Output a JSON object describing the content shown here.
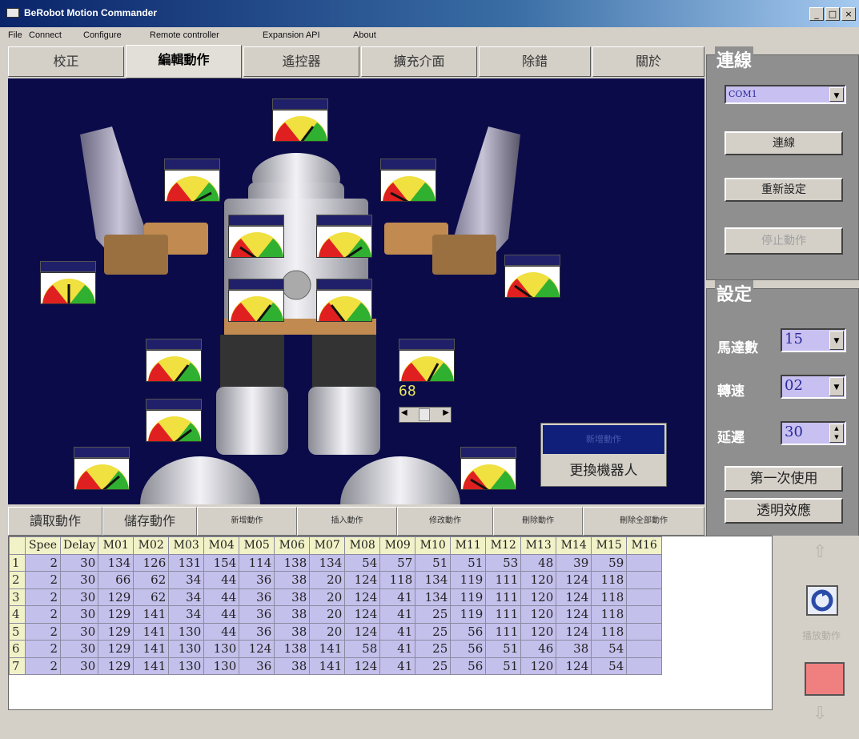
{
  "window": {
    "title": "BeRobot Motion Commander",
    "min": "_",
    "max": "□",
    "close": "×"
  },
  "menu": [
    "File",
    "Connect",
    "Configure",
    "Remote controller",
    "Expansion API",
    "About"
  ],
  "tabs": [
    "校正",
    "編輯動作",
    "遙控器",
    "擴充介面",
    "除錯",
    "關於"
  ],
  "active_tab": 1,
  "robot_view": {
    "gauge_value": "68",
    "popup_top": "新增動作",
    "popup_bottom": "更換機器人"
  },
  "connection": {
    "title": "連線",
    "port": "COM1",
    "connect_button": "連線",
    "reset_button": "重新設定",
    "stop_button": "停止動作"
  },
  "settings": {
    "title": "設定",
    "motor_count_label": "馬達數",
    "motor_count": "15",
    "speed_label": "轉速",
    "speed": "02",
    "delay_label": "延遲",
    "delay": "30",
    "first_use_button": "第一次使用",
    "transparent_button": "透明效應"
  },
  "actions": [
    "讀取動作",
    "儲存動作",
    "新增動作",
    "插入動作",
    "修改動作",
    "刪除動作",
    "刪除全部動作"
  ],
  "table": {
    "headers": [
      "",
      "Spee",
      "Delay",
      "M01",
      "M02",
      "M03",
      "M04",
      "M05",
      "M06",
      "M07",
      "M08",
      "M09",
      "M10",
      "M11",
      "M12",
      "M13",
      "M14",
      "M15",
      "M16"
    ],
    "rows": [
      [
        "1",
        "2",
        "30",
        "134",
        "126",
        "131",
        "154",
        "114",
        "138",
        "134",
        "54",
        "57",
        "51",
        "51",
        "53",
        "48",
        "39",
        "59",
        ""
      ],
      [
        "2",
        "2",
        "30",
        "66",
        "62",
        "34",
        "44",
        "36",
        "38",
        "20",
        "124",
        "118",
        "134",
        "119",
        "111",
        "120",
        "124",
        "118",
        ""
      ],
      [
        "3",
        "2",
        "30",
        "129",
        "62",
        "34",
        "44",
        "36",
        "38",
        "20",
        "124",
        "41",
        "134",
        "119",
        "111",
        "120",
        "124",
        "118",
        ""
      ],
      [
        "4",
        "2",
        "30",
        "129",
        "141",
        "34",
        "44",
        "36",
        "38",
        "20",
        "124",
        "41",
        "25",
        "119",
        "111",
        "120",
        "124",
        "118",
        ""
      ],
      [
        "5",
        "2",
        "30",
        "129",
        "141",
        "130",
        "44",
        "36",
        "38",
        "20",
        "124",
        "41",
        "25",
        "56",
        "111",
        "120",
        "124",
        "118",
        ""
      ],
      [
        "6",
        "2",
        "30",
        "129",
        "141",
        "130",
        "130",
        "124",
        "138",
        "141",
        "58",
        "41",
        "25",
        "56",
        "51",
        "46",
        "38",
        "54",
        ""
      ],
      [
        "7",
        "2",
        "30",
        "129",
        "141",
        "130",
        "130",
        "36",
        "38",
        "141",
        "124",
        "41",
        "25",
        "56",
        "51",
        "120",
        "124",
        "54",
        ""
      ]
    ]
  },
  "side": {
    "play_label": "播放動作"
  }
}
